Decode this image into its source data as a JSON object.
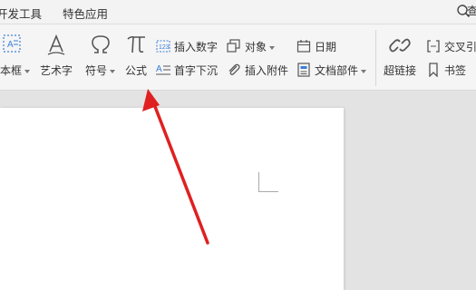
{
  "menubar": {
    "items": [
      "开发工具",
      "特色应用"
    ],
    "search_hint": "查"
  },
  "ribbon": {
    "textbox": {
      "label": "本框"
    },
    "art_text": {
      "label": "艺术字"
    },
    "symbol": {
      "label": "符号"
    },
    "formula": {
      "label": "公式"
    },
    "insert_number": {
      "label": "插入数字"
    },
    "object": {
      "label": "对象"
    },
    "date": {
      "label": "日期"
    },
    "drop_cap": {
      "label": "首字下沉"
    },
    "attachment": {
      "label": "插入附件"
    },
    "doc_parts": {
      "label": "文档部件"
    },
    "hyperlink": {
      "label": "超链接"
    },
    "cross_ref": {
      "label": "交叉引"
    },
    "bookmark": {
      "label": "书签"
    }
  },
  "colors": {
    "arrow": "#e02020",
    "menubar_bg": "#f3f3f3",
    "ribbon_bg": "#f5f5f5",
    "workspace_bg": "#e3e3e3"
  }
}
